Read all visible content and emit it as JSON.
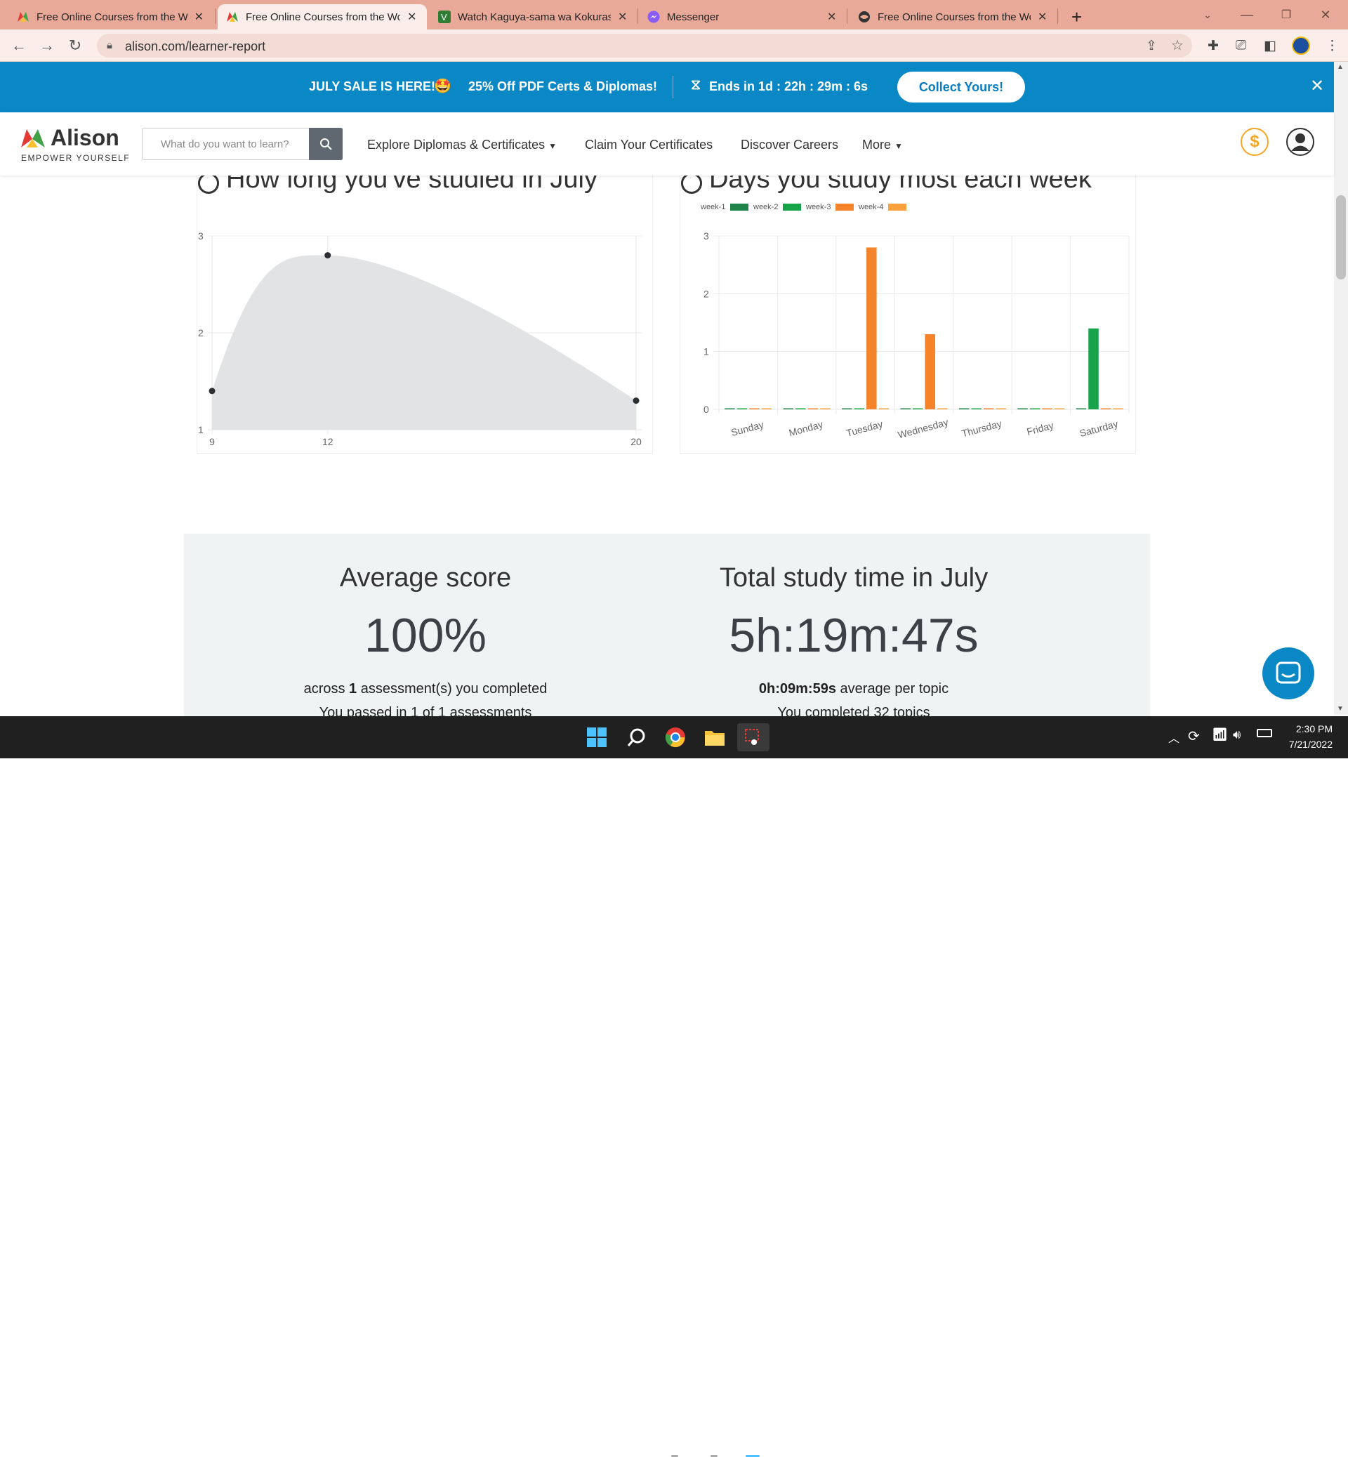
{
  "browser": {
    "tabs": [
      {
        "title": "Free Online Courses from the Wo",
        "active": false
      },
      {
        "title": "Free Online Courses from the Wo",
        "active": true
      },
      {
        "title": "Watch Kaguya-sama wa Kokurase",
        "active": false
      },
      {
        "title": "Messenger",
        "active": false
      },
      {
        "title": "Free Online Courses from the Wo",
        "active": false
      }
    ],
    "new_tab": "+",
    "url": "alison.com/learner-report"
  },
  "promo": {
    "sale": "JULY SALE IS HERE!",
    "offer": "25% Off PDF Certs & Diplomas!",
    "timer": "Ends in 1d : 22h : 29m : 6s",
    "cta": "Collect Yours!"
  },
  "header": {
    "logo": "Alison",
    "tagline": "EMPOWER YOURSELF",
    "search_placeholder": "What do you want to learn?",
    "nav": [
      "Explore Diplomas & Certificates",
      "Claim Your Certificates",
      "Discover Careers",
      "More"
    ],
    "colors": {
      "brand_green": "#4caf50",
      "promo_bg": "#0a87c5",
      "coin": "#f5a623"
    }
  },
  "charts": {
    "left_title": "How long you've studied in July",
    "right_title": "Days you study most each week"
  },
  "chart_data": [
    {
      "type": "area",
      "title": "How long you've studied in July",
      "x": [
        9,
        12,
        20
      ],
      "y": [
        1.4,
        2.8,
        1.3
      ],
      "xticks": [
        "9",
        "12",
        "20"
      ],
      "yticks": [
        "1",
        "2",
        "3"
      ],
      "ylim": [
        1,
        3
      ],
      "grid": true
    },
    {
      "type": "bar",
      "title": "Days you study most each week",
      "categories": [
        "Sunday",
        "Monday",
        "Tuesday",
        "Wednesday",
        "Thursday",
        "Friday",
        "Saturday"
      ],
      "series": [
        {
          "name": "week-1",
          "color": "#1e8449",
          "values": [
            0,
            0,
            0,
            0,
            0,
            0,
            0
          ]
        },
        {
          "name": "week-2",
          "color": "#16a34a",
          "values": [
            0,
            0,
            0,
            0,
            0,
            0,
            1.4
          ]
        },
        {
          "name": "week-3",
          "color": "#f5832a",
          "values": [
            0,
            0,
            2.8,
            1.3,
            0,
            0,
            0
          ]
        },
        {
          "name": "week-4",
          "color": "#f9a13c",
          "values": [
            0,
            0,
            0,
            0,
            0,
            0,
            0
          ]
        }
      ],
      "yticks": [
        "0",
        "1",
        "2",
        "3"
      ],
      "ylim": [
        0,
        3
      ],
      "legend": "top-left",
      "grid": true
    }
  ],
  "stats": {
    "avg_title": "Average score",
    "avg_value": "100%",
    "avg_sub_pre": "across",
    "avg_sub_num": "1",
    "avg_sub_post": "assessment(s) you completed",
    "avg_sub2": "You passed in 1 of 1 assessments",
    "time_title": "Total study time in July",
    "time_value": "5h:19m:47s",
    "time_sub_bold": "0h:09m:59s",
    "time_sub_post": "average per topic",
    "time_sub2": "You completed 32 topics"
  },
  "taskbar": {
    "time": "2:30 PM",
    "date": "7/21/2022"
  }
}
